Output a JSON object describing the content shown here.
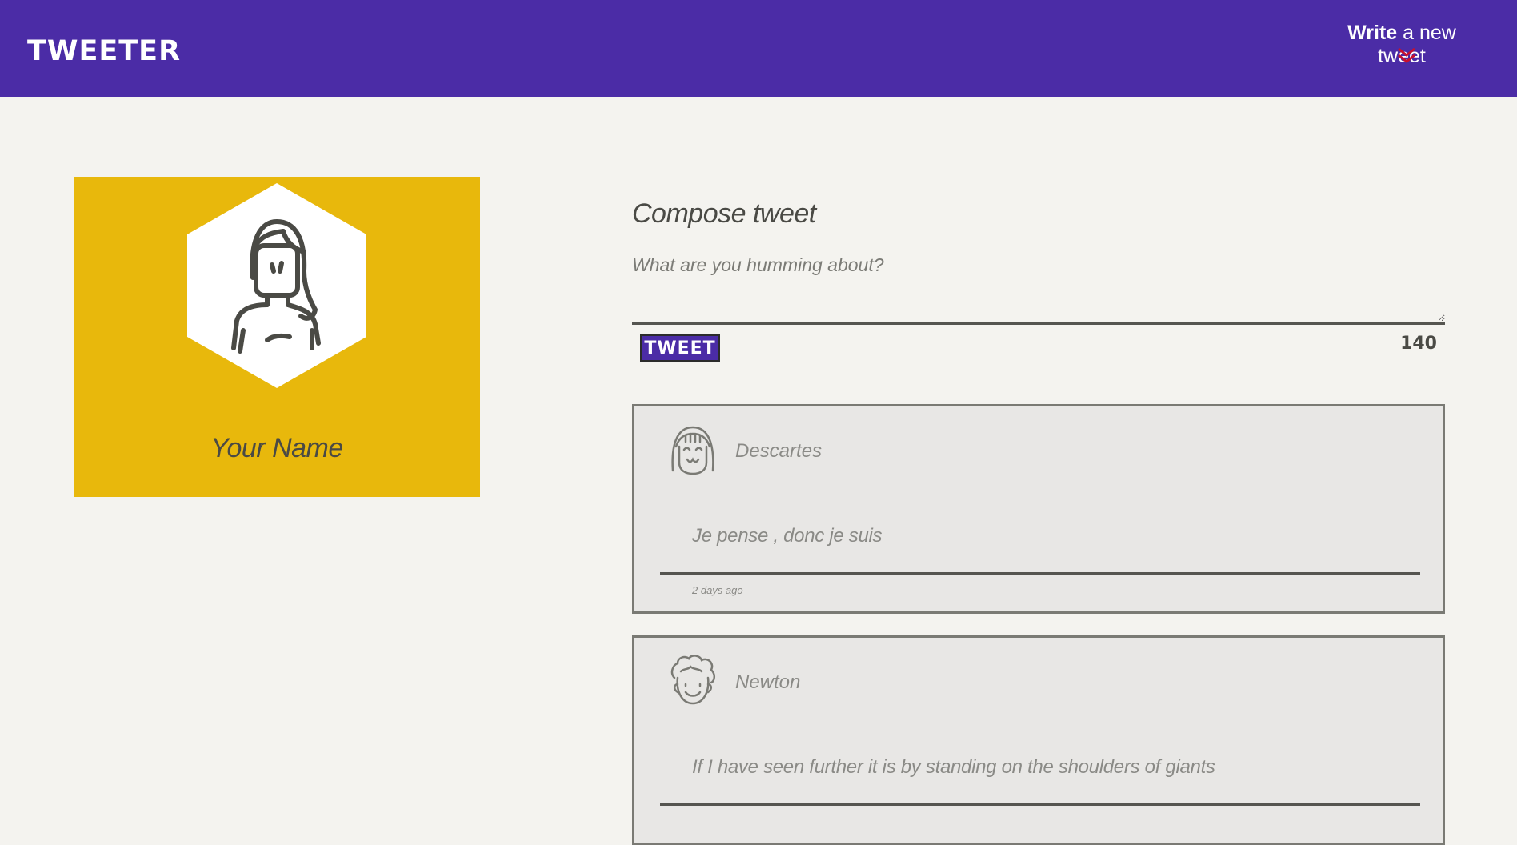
{
  "header": {
    "brand": "TWEETER",
    "write_bold": "Write",
    "write_rest": " a new tweet",
    "chevron_icon": "double-chevron-down-icon",
    "background": "#4b2ca6",
    "chevron_color": "#c8102e"
  },
  "profile": {
    "name": "Your Name",
    "avatar_icon": "girl-avatar-icon",
    "background": "#e8b80c"
  },
  "compose": {
    "title": "Compose tweet",
    "placeholder": "What are you humming about?",
    "value": "",
    "button_label": "TWEET",
    "counter": "140"
  },
  "tweets": [
    {
      "author": "Descartes",
      "avatar_icon": "girl-face-icon",
      "content": "Je pense , donc je suis",
      "timestamp": "2 days ago"
    },
    {
      "author": "Newton",
      "avatar_icon": "curly-hair-face-icon",
      "content": "If I have seen further it is by standing on the shoulders of giants",
      "timestamp": ""
    }
  ]
}
